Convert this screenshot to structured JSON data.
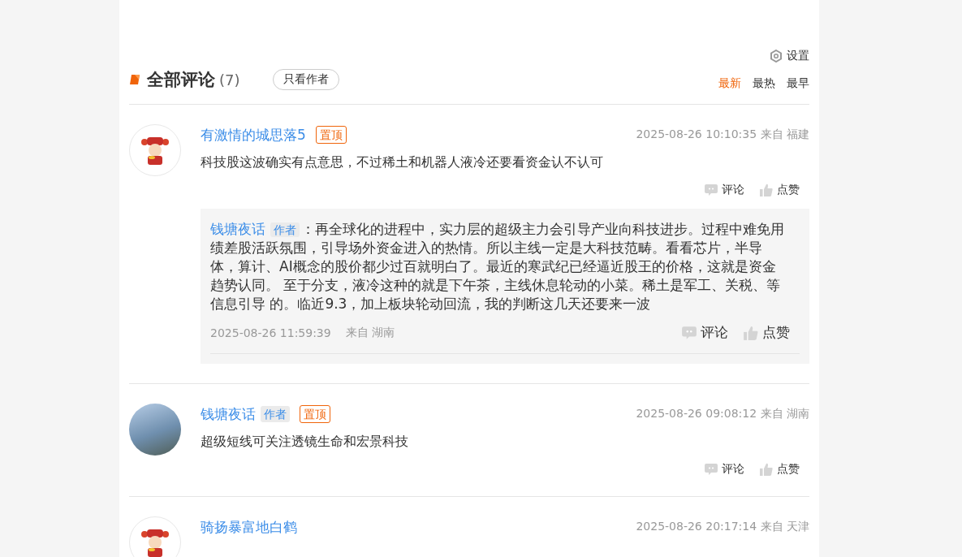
{
  "settings": {
    "label": "设置"
  },
  "header": {
    "title": "全部评论",
    "count": "(7)",
    "author_only": "只看作者"
  },
  "sort_tabs": [
    {
      "label": "最新",
      "selected": true
    },
    {
      "label": "最热",
      "selected": false
    },
    {
      "label": "最早",
      "selected": false
    }
  ],
  "comments": [
    {
      "avatar": {
        "kind": "cartoon"
      },
      "user": "有激情的城思落5",
      "badges": [
        {
          "kind": "pinned",
          "label": "置顶"
        }
      ],
      "time": "2025-08-26 10:10:35 来自 福建",
      "text": "科技股这波确实有点意思，不过稀土和机器人液冷还要看资金认不认可",
      "actions": [
        "评论",
        "点赞"
      ],
      "replies": [
        {
          "user": "钱塘夜话",
          "badges": [
            {
              "kind": "author",
              "label": "作者"
            }
          ],
          "text": "：再全球化的进程中，实力层的超级主力会引导产业向科技进步。过程中难免用绩差股活跃氛围，引导场外资金进入的热情。所以主线一定是大科技范畴。看看芯片，半导体，算计、AI概念的股价都少过百就明白了。最近的寒武纪已经逼近股王的价格，这就是资金趋势认同。 至于分支，液冷这种的就是下午茶，主线休息轮动的小菜。稀土是军工、关税、等信息引导 的。临近9.3，加上板块轮动回流，我的判断这几天还要来一波",
          "time": "2025-08-26 11:59:39",
          "location": "来自 湖南",
          "actions": [
            "评论",
            "点赞"
          ]
        }
      ]
    },
    {
      "avatar": {
        "kind": "photo"
      },
      "user": "钱塘夜话",
      "badges": [
        {
          "kind": "author",
          "label": "作者"
        },
        {
          "kind": "pinned",
          "label": "置顶"
        }
      ],
      "time": "2025-08-26 09:08:12 来自 湖南",
      "text": "超级短线可关注透镜生命和宏景科技",
      "actions": [
        "评论",
        "点赞"
      ]
    },
    {
      "avatar": {
        "kind": "cartoon"
      },
      "user": "骑扬暴富地白鹤",
      "time": "2025-08-26 20:17:14 来自 天津"
    }
  ]
}
